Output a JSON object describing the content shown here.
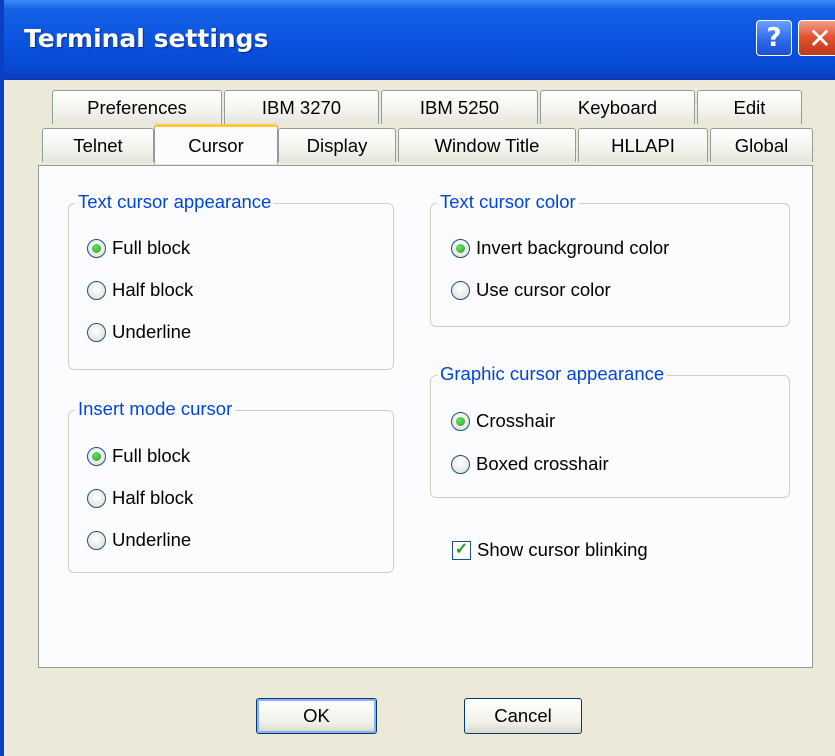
{
  "window": {
    "title": "Terminal settings",
    "help_label": "?",
    "close_label": "✕"
  },
  "tabs": {
    "row1": [
      "Preferences",
      "IBM 3270",
      "IBM 5250",
      "Keyboard",
      "Edit"
    ],
    "row2": [
      "Telnet",
      "Cursor",
      "Display",
      "Window Title",
      "HLLAPI",
      "Global"
    ],
    "active": "Cursor"
  },
  "groups": {
    "text_cursor_appearance": {
      "label": "Text cursor appearance",
      "options": [
        "Full block",
        "Half block",
        "Underline"
      ],
      "selected": "Full block"
    },
    "insert_mode_cursor": {
      "label": "Insert mode cursor",
      "options": [
        "Full block",
        "Half block",
        "Underline"
      ],
      "selected": "Full block"
    },
    "text_cursor_color": {
      "label": "Text cursor color",
      "options": [
        "Invert background color",
        "Use cursor color"
      ],
      "selected": "Invert background color"
    },
    "graphic_cursor_appearance": {
      "label": "Graphic cursor appearance",
      "options": [
        "Crosshair",
        "Boxed crosshair"
      ],
      "selected": "Crosshair"
    }
  },
  "show_cursor_blinking": {
    "label": "Show cursor blinking",
    "checked": true
  },
  "buttons": {
    "ok": "OK",
    "cancel": "Cancel"
  },
  "colors": {
    "titlebar": "#0a54e0",
    "group_label": "#0046d5",
    "active_tab_accent": "#ffc73c",
    "dialog_bg": "#ece9d8"
  }
}
